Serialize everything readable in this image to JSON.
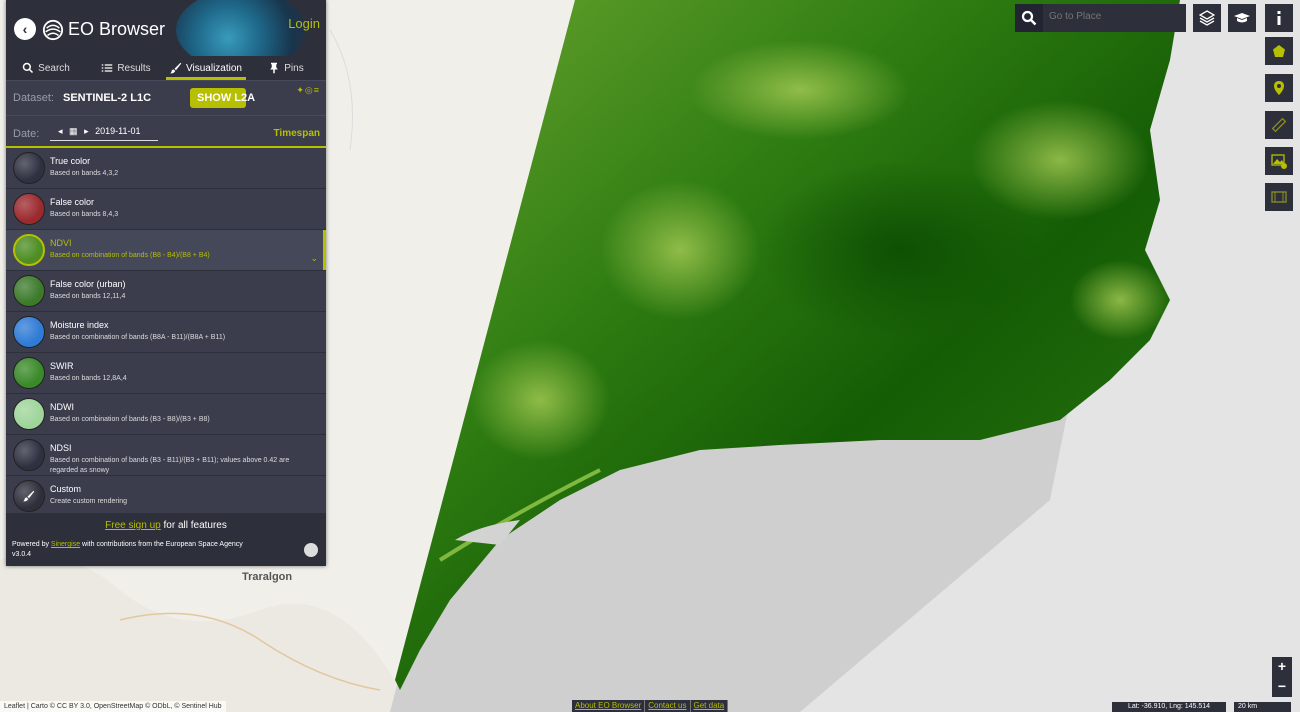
{
  "header": {
    "app_title": "EO Browser",
    "login": "Login"
  },
  "tabs": [
    {
      "label": "Search",
      "icon": "search-icon"
    },
    {
      "label": "Results",
      "icon": "list-icon"
    },
    {
      "label": "Visualization",
      "icon": "brush-icon",
      "active": true
    },
    {
      "label": "Pins",
      "icon": "pin-icon"
    }
  ],
  "dataset": {
    "label": "Dataset:",
    "name": "SENTINEL-2 L1C",
    "button": "SHOW L2A"
  },
  "date": {
    "label": "Date:",
    "value": "2019-11-01",
    "timespan": "Timespan"
  },
  "layers": [
    {
      "name": "True color",
      "desc": "Based on bands 4,3,2",
      "color": "#2e3140"
    },
    {
      "name": "False color",
      "desc": "Based on bands 8,4,3",
      "color": "#9b2a2f"
    },
    {
      "name": "NDVI",
      "desc": "Based on combination of bands (B8 - B4)/(B8 + B4)",
      "color": "#4d8d23",
      "active": true
    },
    {
      "name": "False color (urban)",
      "desc": "Based on bands 12,11,4",
      "color": "#3d7a2c"
    },
    {
      "name": "Moisture index",
      "desc": "Based on combination of bands (B8A - B11)/(B8A + B11)",
      "color": "#2f7bd6"
    },
    {
      "name": "SWIR",
      "desc": "Based on bands 12,8A,4",
      "color": "#3a8a2a"
    },
    {
      "name": "NDWI",
      "desc": "Based on combination of bands (B3 - B8)/(B3 + B8)",
      "color": "#9fd59a"
    },
    {
      "name": "NDSI",
      "desc": "Based on combination of bands (B3 - B11)/(B3 + B11); values above 0.42 are regarded as snowy",
      "color": "#2e3140"
    },
    {
      "name": "Custom",
      "desc": "Create custom rendering",
      "color": "#2d2f3b"
    }
  ],
  "footer": {
    "signup_link": "Free sign up",
    "signup_rest": " for all features",
    "powered_pre": "Powered by ",
    "powered_link": "Sinergise",
    "powered_post": " with contributions from the European Space Agency",
    "version": "v3.0.4"
  },
  "search": {
    "placeholder": "Go to Place"
  },
  "map": {
    "place_label": "Traralgon",
    "attribution": "Leaflet | Carto © CC BY 3.0, OpenStreetMap © ODbL, © Sentinel Hub",
    "links": [
      "About EO Browser",
      "Contact us",
      "Get data"
    ],
    "coords": "Lat: -36.910, Lng: 145.514",
    "scale": "20 km",
    "zoom_in": "+",
    "zoom_out": "−"
  },
  "colors": {
    "accent": "#b6bf00",
    "panel": "#3b3d4d",
    "panel_dark": "#2d2f3b"
  }
}
